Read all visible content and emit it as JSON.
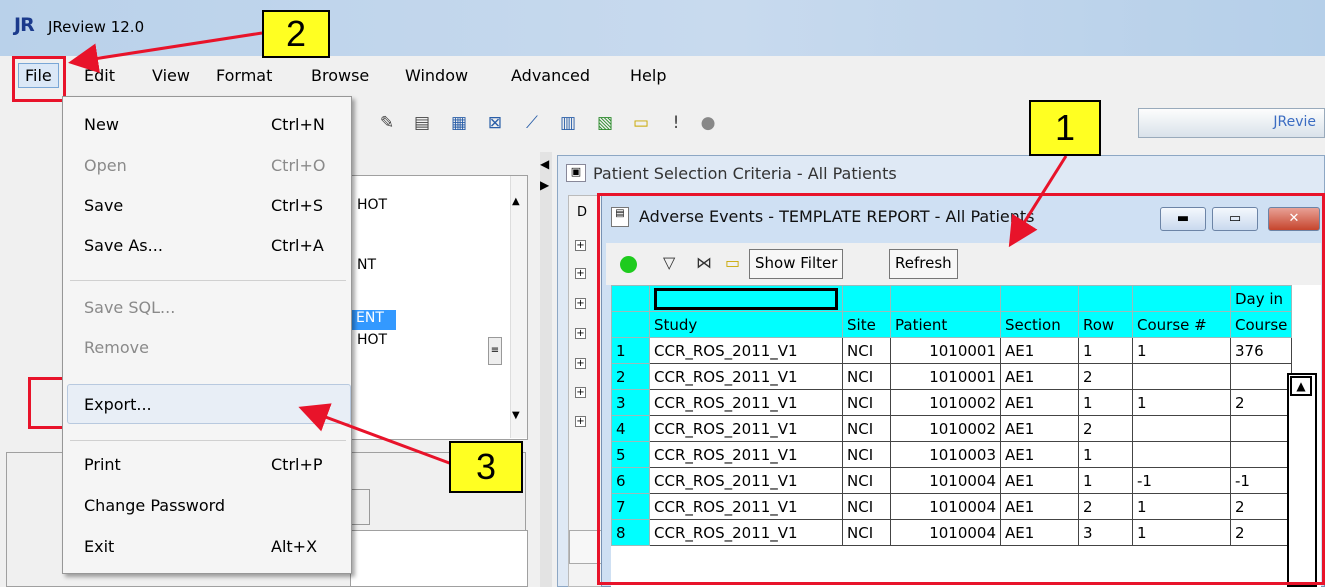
{
  "app": {
    "logo": "JR",
    "title": "JReview 12.0"
  },
  "menubar": [
    "File",
    "Edit",
    "View",
    "Format",
    "Browse",
    "Window",
    "Advanced",
    "Help"
  ],
  "toolbar": {
    "jreview_field": "JRevie"
  },
  "file_menu": {
    "items": [
      {
        "label": "New",
        "shortcut": "Ctrl+N",
        "enabled": true
      },
      {
        "label": "Open",
        "shortcut": "Ctrl+O",
        "enabled": false
      },
      {
        "label": "Save",
        "shortcut": "Ctrl+S",
        "enabled": true
      },
      {
        "label": "Save As...",
        "shortcut": "Ctrl+A",
        "enabled": true
      },
      {
        "label": "Save SQL...",
        "shortcut": "",
        "enabled": false
      },
      {
        "label": "Remove",
        "shortcut": "",
        "enabled": false
      },
      {
        "label": "Export...",
        "shortcut": "",
        "enabled": true,
        "highlighted": true
      },
      {
        "label": "Print",
        "shortcut": "Ctrl+P",
        "enabled": true
      },
      {
        "label": "Change Password",
        "shortcut": "",
        "enabled": true
      },
      {
        "label": "Exit",
        "shortcut": "Alt+X",
        "enabled": true
      }
    ]
  },
  "tree_panel": {
    "fragments": [
      "HOT",
      "NT",
      "ENT",
      "HOT"
    ],
    "selected": "ENT"
  },
  "patient_selection": {
    "title": "Patient Selection Criteria - All Patients",
    "label_fragment": "D"
  },
  "adverse_events": {
    "title": "Adverse Events - TEMPLATE  REPORT - All Patients",
    "buttons": {
      "show_filter": "Show Filter",
      "refresh": "Refresh"
    },
    "columns_top": [
      "",
      "",
      "",
      "",
      "",
      "",
      "",
      "Day in"
    ],
    "columns": [
      "",
      "Study",
      "Site",
      "Patient",
      "Section",
      "Row",
      "Course #",
      "Course"
    ],
    "rows": [
      [
        "1",
        "CCR_ROS_2011_V1",
        "NCI",
        "1010001",
        "AE1",
        "1",
        "1",
        "376"
      ],
      [
        "2",
        "CCR_ROS_2011_V1",
        "NCI",
        "1010001",
        "AE1",
        "2",
        "",
        ""
      ],
      [
        "3",
        "CCR_ROS_2011_V1",
        "NCI",
        "1010002",
        "AE1",
        "1",
        "1",
        "2"
      ],
      [
        "4",
        "CCR_ROS_2011_V1",
        "NCI",
        "1010002",
        "AE1",
        "2",
        "",
        ""
      ],
      [
        "5",
        "CCR_ROS_2011_V1",
        "NCI",
        "1010003",
        "AE1",
        "1",
        "",
        ""
      ],
      [
        "6",
        "CCR_ROS_2011_V1",
        "NCI",
        "1010004",
        "AE1",
        "1",
        "-1",
        "-1"
      ],
      [
        "7",
        "CCR_ROS_2011_V1",
        "NCI",
        "1010004",
        "AE1",
        "2",
        "1",
        "2"
      ],
      [
        "8",
        "CCR_ROS_2011_V1",
        "NCI",
        "1010004",
        "AE1",
        "3",
        "1",
        "2"
      ]
    ]
  },
  "annotations": {
    "one": "1",
    "two": "2",
    "three": "3"
  },
  "colors": {
    "highlight": "#e8132a",
    "callout_fill": "#ffff22",
    "grid_header": "#00ffff"
  }
}
